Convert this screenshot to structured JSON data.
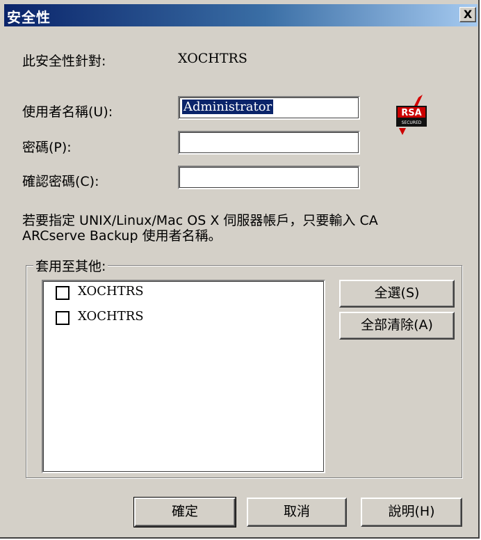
{
  "window": {
    "title": "安全性",
    "close_symbol": "X"
  },
  "target": {
    "label": "此安全性針對:",
    "value": "XOCHTRS"
  },
  "username": {
    "label": "使用者名稱(U):",
    "value": "Administrator"
  },
  "password": {
    "label": "密碼(P):",
    "value": ""
  },
  "confirm": {
    "label": "確認密碼(C):",
    "value": ""
  },
  "badge": {
    "brand": "RSA",
    "sub": "SECURED"
  },
  "info": {
    "line1": "若要指定 UNIX/Linux/Mac OS X 伺服器帳戶，只要輸入 CA",
    "line2": "ARCserve Backup 使用者名稱。"
  },
  "apply_group": {
    "label": "套用至其他:",
    "items": [
      {
        "label": "XOCHTRS",
        "checked": false
      },
      {
        "label": "XOCHTRS",
        "checked": false
      }
    ],
    "select_all": "全選(S)",
    "clear_all": "全部清除(A)"
  },
  "footer": {
    "ok": "確定",
    "cancel": "取消",
    "help": "說明(H)"
  }
}
